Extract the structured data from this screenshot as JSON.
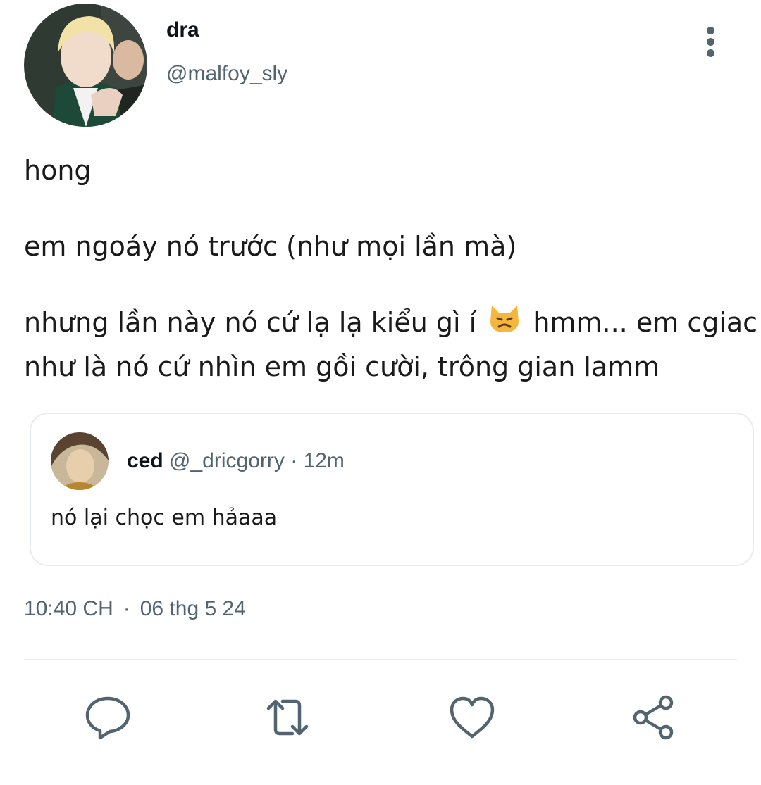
{
  "author": {
    "name": "dra",
    "handle": "@malfoy_sly"
  },
  "tweet": {
    "paragraphs": [
      "hong",
      "em ngoáy nó trước (như mọi lần mà)"
    ],
    "paragraph3_before": "nhưng lần này nó cứ lạ lạ kiểu gì í",
    "paragraph3_after": "hmm... em cgiac",
    "paragraph3_line2": "như là nó cứ nhìn em gồi cười, trông gian lamm",
    "emoji": "pouting-cat-face"
  },
  "quoted": {
    "name": "ced",
    "handle": "@_dricgorry",
    "separator": "·",
    "time": "12m",
    "text": "nó lại chọc em hảaaa"
  },
  "meta": {
    "time": "10:40 CH",
    "separator": "·",
    "date": "06 thg 5 24"
  },
  "actions": {
    "reply_icon": "reply-icon",
    "retweet_icon": "retweet-icon",
    "like_icon": "heart-icon",
    "share_icon": "share-icon"
  },
  "colors": {
    "secondary_text": "#536471",
    "border": "#e6ecf0",
    "emoji_fill": "#f4b63f"
  }
}
